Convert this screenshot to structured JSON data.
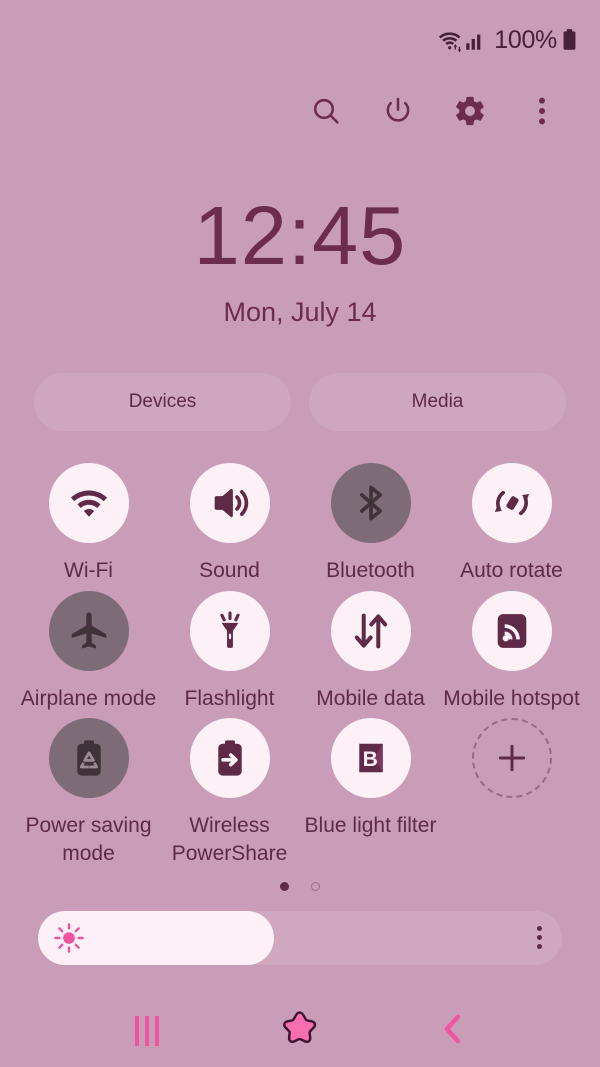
{
  "status_bar": {
    "wifi_icon": "wifi-transfer-icon",
    "signal_icon": "cellular-signal-icon",
    "battery_percent": "100%",
    "battery_icon": "battery-full-icon"
  },
  "header": {
    "actions": [
      {
        "name": "search-icon",
        "label": "Search"
      },
      {
        "name": "power-icon",
        "label": "Power"
      },
      {
        "name": "settings-icon",
        "label": "Settings"
      },
      {
        "name": "overflow-icon",
        "label": "More options"
      }
    ]
  },
  "clock": {
    "time": "12:45",
    "date": "Mon, July 14"
  },
  "shortcuts": {
    "devices_label": "Devices",
    "media_label": "Media"
  },
  "tiles": [
    {
      "label": "Wi-Fi",
      "icon": "wifi-icon",
      "state": "on"
    },
    {
      "label": "Sound",
      "icon": "sound-icon",
      "state": "on"
    },
    {
      "label": "Bluetooth",
      "icon": "bluetooth-icon",
      "state": "off"
    },
    {
      "label": "Auto rotate",
      "icon": "auto-rotate-icon",
      "state": "on"
    },
    {
      "label": "Airplane mode",
      "icon": "airplane-icon",
      "state": "off"
    },
    {
      "label": "Flashlight",
      "icon": "flashlight-icon",
      "state": "on"
    },
    {
      "label": "Mobile data",
      "icon": "mobile-data-icon",
      "state": "on"
    },
    {
      "label": "Mobile hotspot",
      "icon": "hotspot-icon",
      "state": "on"
    },
    {
      "label": "Power saving mode",
      "icon": "power-saving-icon",
      "state": "off"
    },
    {
      "label": "Wireless PowerShare",
      "icon": "power-share-icon",
      "state": "on"
    },
    {
      "label": "Blue light filter",
      "icon": "blue-light-icon",
      "state": "on"
    },
    {
      "label": "",
      "icon": "add-icon",
      "state": "add"
    }
  ],
  "pager": {
    "total_pages": 2,
    "active_page": 1
  },
  "brightness": {
    "percent": 45,
    "sun_icon": "brightness-sun-icon",
    "menu_icon": "brightness-options-icon"
  },
  "navbar": {
    "recents_label": "Recents",
    "home_label": "Home",
    "back_label": "Back"
  },
  "colors": {
    "background": "#c99cb7",
    "tile_on": "#fdf0f7",
    "tile_off": "#7e6b78",
    "text": "#5e2a47",
    "accent_pink": "#f0539f"
  }
}
